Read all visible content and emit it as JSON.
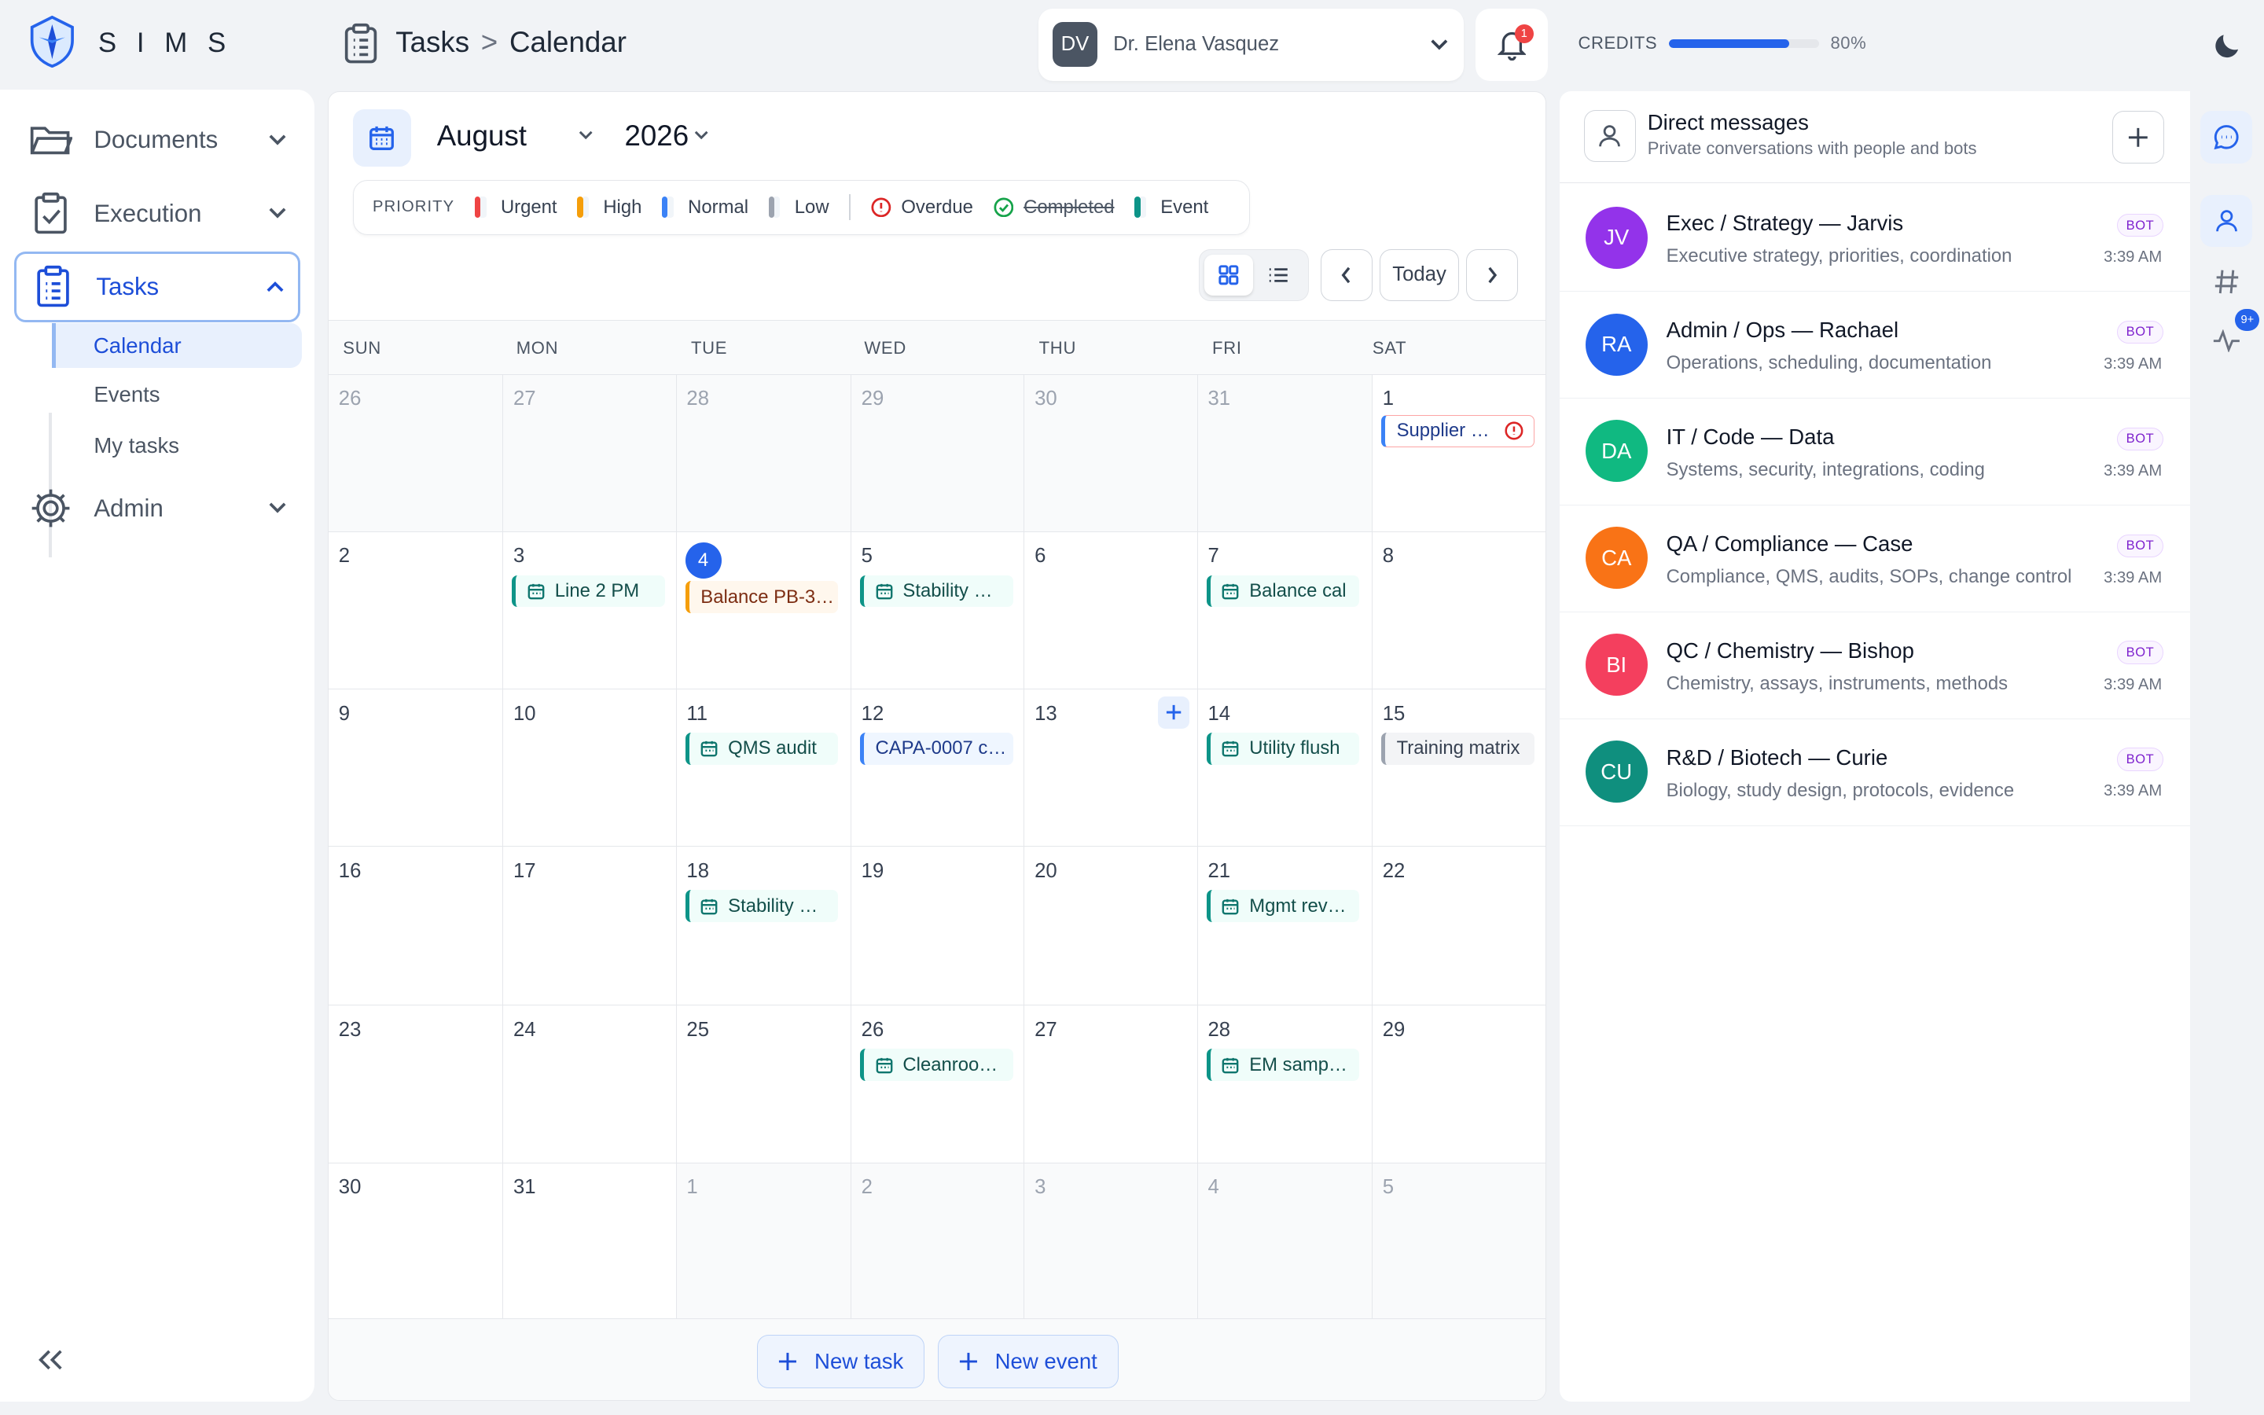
{
  "app": {
    "brand": "SIMS"
  },
  "breadcrumb": {
    "section": "Tasks",
    "separator": ">",
    "page": "Calendar"
  },
  "user": {
    "initials": "DV",
    "name": "Dr. Elena Vasquez"
  },
  "notifications": {
    "count": "1"
  },
  "credits": {
    "label": "CREDITS",
    "percent": "80%",
    "fraction": 0.8
  },
  "sidebar": {
    "items": [
      {
        "label": "Documents",
        "icon": "folder-icon"
      },
      {
        "label": "Execution",
        "icon": "clipboard-check-icon"
      },
      {
        "label": "Tasks",
        "icon": "clipboard-list-icon"
      },
      {
        "label": "Admin",
        "icon": "gear-icon"
      }
    ],
    "sub_items": [
      "Calendar",
      "Events",
      "My tasks"
    ]
  },
  "calendar": {
    "month": "August",
    "year": "2026",
    "legend": {
      "title": "PRIORITY",
      "urgent": "Urgent",
      "high": "High",
      "normal": "Normal",
      "low": "Low",
      "overdue": "Overdue",
      "completed": "Completed",
      "event": "Event"
    },
    "today_label": "Today",
    "weekdays": [
      "SUN",
      "MON",
      "TUE",
      "WED",
      "THU",
      "FRI",
      "SAT"
    ],
    "weeks": [
      [
        "26",
        "27",
        "28",
        "29",
        "30",
        "31",
        "1"
      ],
      [
        "2",
        "3",
        "4",
        "5",
        "6",
        "7",
        "8"
      ],
      [
        "9",
        "10",
        "11",
        "12",
        "13",
        "14",
        "15"
      ],
      [
        "16",
        "17",
        "18",
        "19",
        "20",
        "21",
        "22"
      ],
      [
        "23",
        "24",
        "25",
        "26",
        "27",
        "28",
        "29"
      ],
      [
        "30",
        "31",
        "1",
        "2",
        "3",
        "4",
        "5"
      ]
    ],
    "events": {
      "w0_sat": "Supplier …",
      "w1_mon": "Line 2 PM",
      "w1_tue": "Balance PB-3…",
      "w1_wed": "Stability …",
      "w1_fri": "Balance cal",
      "w2_tue": "QMS audit",
      "w2_wed": "CAPA-0007 c…",
      "w2_fri": "Utility flush",
      "w2_sat": "Training matrix",
      "w3_tue": "Stability …",
      "w3_fri": "Mgmt rev…",
      "w4_wed": "Cleanroo…",
      "w4_fri": "EM samp…"
    },
    "new_task": "New task",
    "new_event": "New event"
  },
  "dm": {
    "title": "Direct messages",
    "subtitle": "Private conversations with people and bots",
    "chats": [
      {
        "initials": "JV",
        "name": "Exec / Strategy — Jarvis",
        "desc": "Executive strategy, priorities, coordination",
        "badge": "BOT",
        "time": "3:39 AM",
        "color": "#9333ea"
      },
      {
        "initials": "RA",
        "name": "Admin / Ops — Rachael",
        "desc": "Operations, scheduling, documentation",
        "badge": "BOT",
        "time": "3:39 AM",
        "color": "#2563eb"
      },
      {
        "initials": "DA",
        "name": "IT / Code — Data",
        "desc": "Systems, security, integrations, coding",
        "badge": "BOT",
        "time": "3:39 AM",
        "color": "#10b981"
      },
      {
        "initials": "CA",
        "name": "QA / Compliance — Case",
        "desc": "Compliance, QMS, audits, SOPs, change control",
        "badge": "BOT",
        "time": "3:39 AM",
        "color": "#f97316"
      },
      {
        "initials": "BI",
        "name": "QC / Chemistry — Bishop",
        "desc": "Chemistry, assays, instruments, methods",
        "badge": "BOT",
        "time": "3:39 AM",
        "color": "#f43f5e"
      },
      {
        "initials": "CU",
        "name": "R&D / Biotech — Curie",
        "desc": "Biology, study design, protocols, evidence",
        "badge": "BOT",
        "time": "3:39 AM",
        "color": "#0f8f7e"
      }
    ]
  },
  "rail": {
    "activity_badge": "9+"
  },
  "colors": {
    "accent": "#2563eb",
    "urgent": "#ef4444",
    "high": "#f59e0b",
    "normal": "#3b82f6",
    "low": "#9ca3af",
    "event": "#0d9488"
  }
}
